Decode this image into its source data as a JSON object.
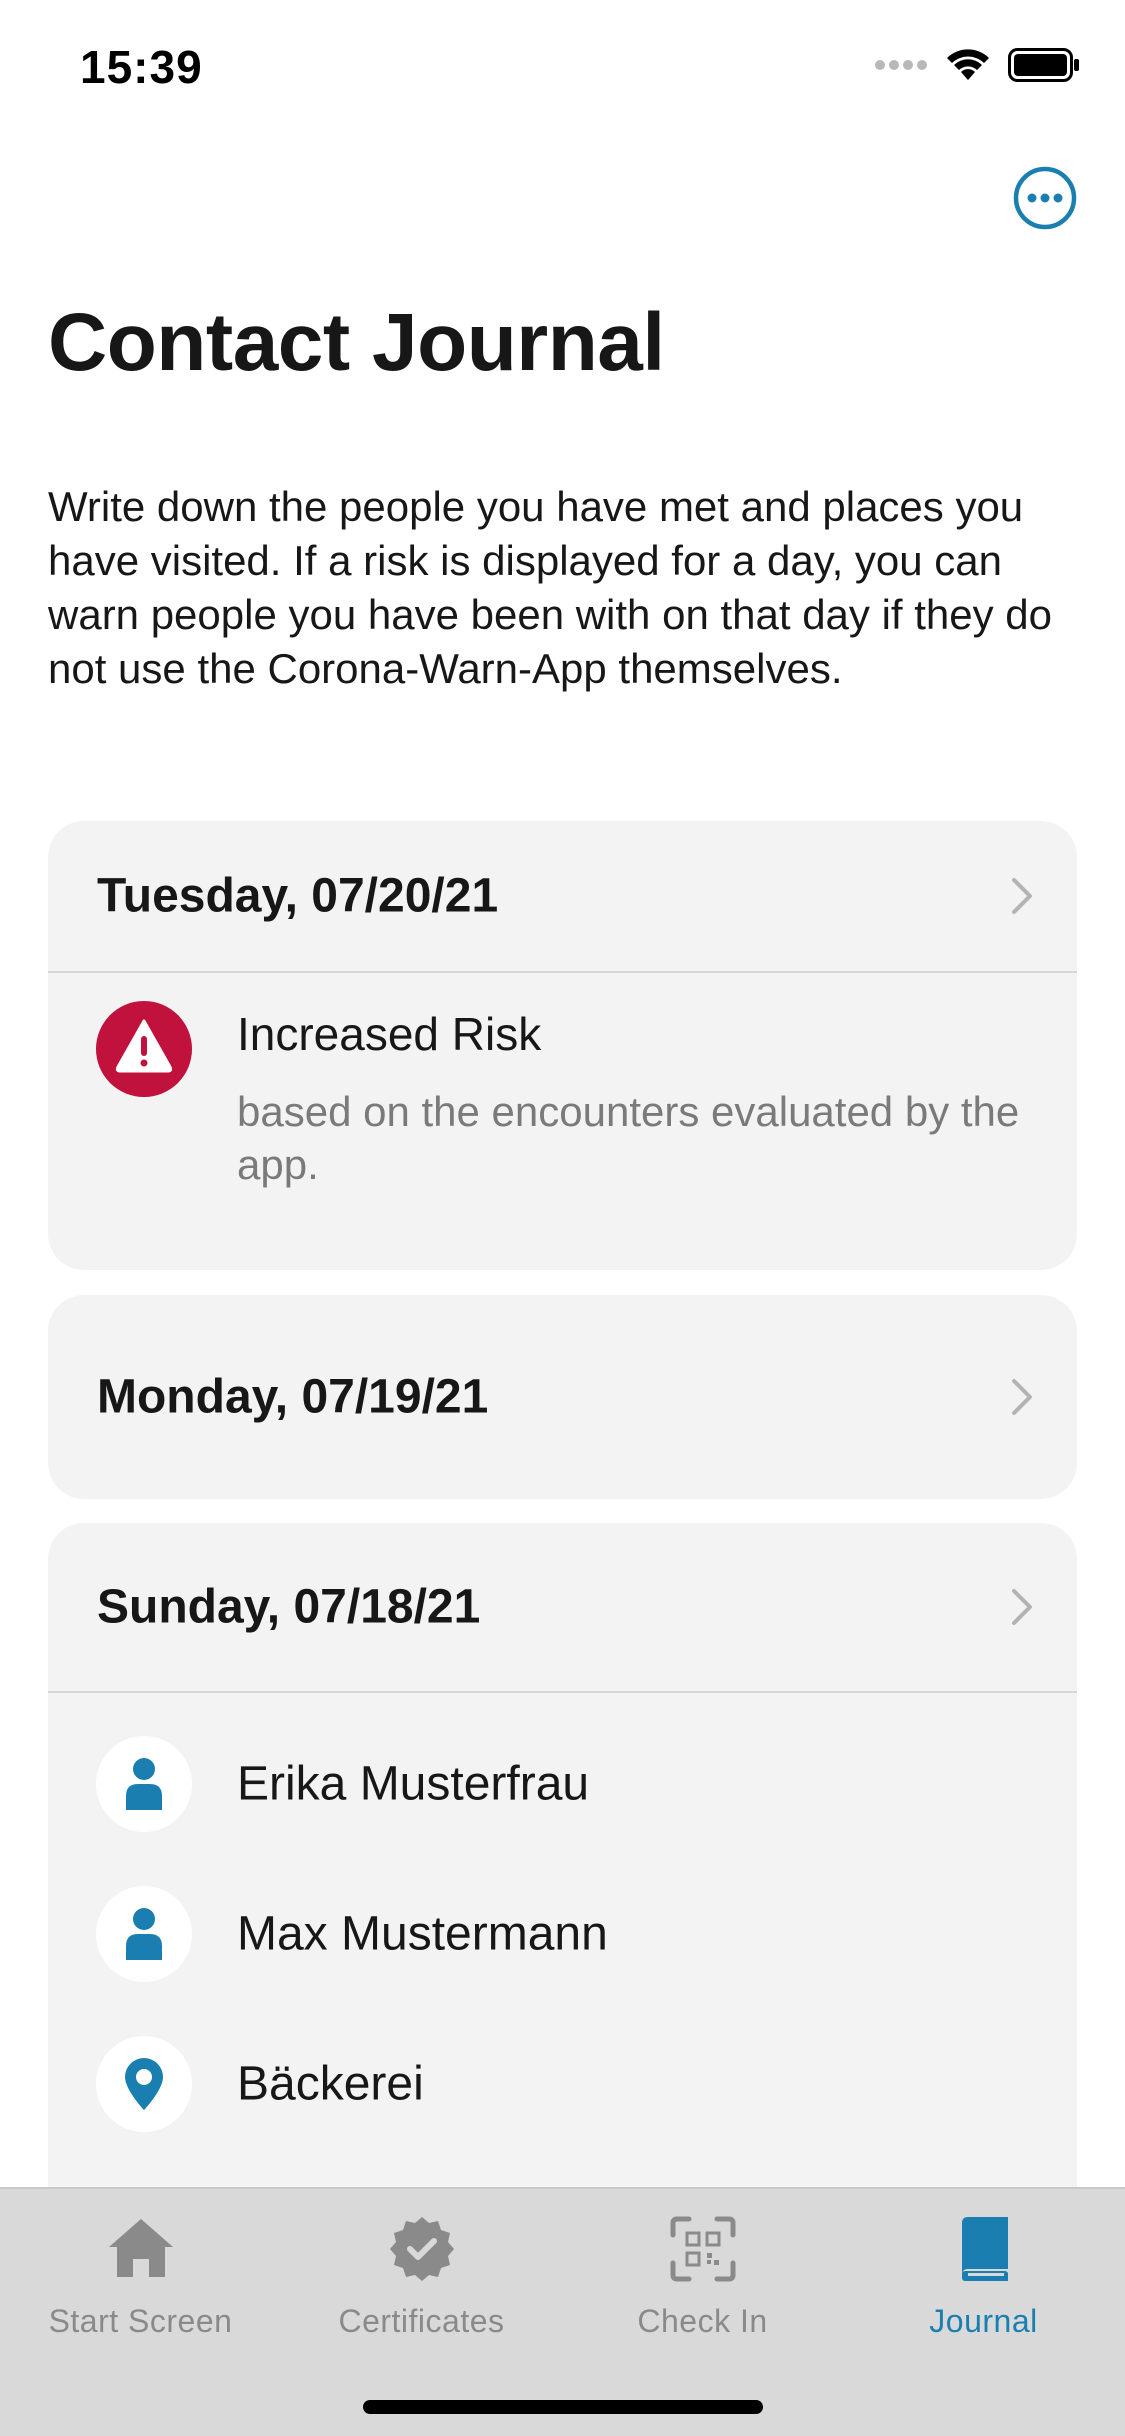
{
  "status_bar": {
    "time": "15:39"
  },
  "header": {
    "title": "Contact Journal",
    "more_icon": "ellipsis-circle-icon"
  },
  "description": "Write down the people you have met and places you have visited. If a risk is displayed for a day, you can warn people you have been with on that day if they do not use the Corona-Warn-App themselves.",
  "days": [
    {
      "date": "Tuesday, 07/20/21",
      "risk": {
        "title": "Increased Risk",
        "subtitle": "based on the encounters evaluated by the app.",
        "icon": "warning-icon",
        "color": "#c0123c"
      }
    },
    {
      "date": "Monday, 07/19/21"
    },
    {
      "date": "Sunday, 07/18/21",
      "entries": [
        {
          "label": "Erika Musterfrau",
          "icon": "person-icon"
        },
        {
          "label": "Max Mustermann",
          "icon": "person-icon"
        },
        {
          "label": "Bäckerei",
          "icon": "location-pin-icon"
        }
      ]
    }
  ],
  "tab_bar": {
    "tabs": [
      {
        "label": "Start Screen",
        "icon": "home-icon",
        "active": false
      },
      {
        "label": "Certificates",
        "icon": "certificate-badge-icon",
        "active": false
      },
      {
        "label": "Check In",
        "icon": "qr-code-icon",
        "active": false
      },
      {
        "label": "Journal",
        "icon": "book-icon",
        "active": true
      }
    ]
  },
  "colors": {
    "accent": "#1a7fb0",
    "risk_red": "#c0123c",
    "card_bg": "#f3f3f3",
    "tab_inactive": "#8a8a8a"
  }
}
